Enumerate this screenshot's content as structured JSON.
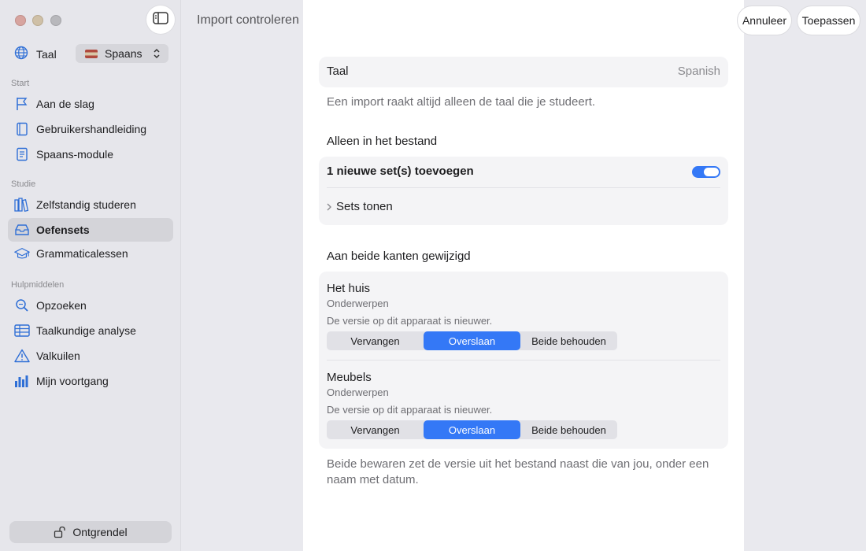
{
  "sidebar": {
    "language_label": "Taal",
    "language_value": "Spaans",
    "sections": [
      {
        "title": "Start",
        "items": [
          {
            "label": "Aan de slag",
            "icon": "flag-icon"
          },
          {
            "label": "Gebruikershandleiding",
            "icon": "book-icon"
          },
          {
            "label": "Spaans-module",
            "icon": "document-icon"
          }
        ]
      },
      {
        "title": "Studie",
        "items": [
          {
            "label": "Zelfstandig studeren",
            "icon": "books-icon"
          },
          {
            "label": "Oefensets",
            "icon": "tray-icon",
            "active": true
          },
          {
            "label": "Grammaticalessen",
            "icon": "graduation-cap-icon"
          }
        ]
      },
      {
        "title": "Hulpmiddelen",
        "items": [
          {
            "label": "Opzoeken",
            "icon": "magnifier-icon"
          },
          {
            "label": "Taalkundige analyse",
            "icon": "table-icon"
          },
          {
            "label": "Valkuilen",
            "icon": "warning-icon"
          },
          {
            "label": "Mijn voortgang",
            "icon": "chart-icon"
          }
        ]
      }
    ],
    "unlock_label": "Ontgrendel"
  },
  "header": {
    "title": "Import controleren",
    "cancel_label": "Annuleer",
    "apply_label": "Toepassen"
  },
  "main": {
    "language_row": {
      "label": "Taal",
      "value": "Spanish"
    },
    "language_hint": "Een import raakt altijd alleen de taal die je studeert.",
    "file_only_heading": "Alleen in het bestand",
    "add_sets_label": "1 nieuwe set(s) toevoegen",
    "add_sets_enabled": true,
    "show_sets_label": "Sets tonen",
    "changed_heading": "Aan beide kanten gewijzigd",
    "conflicts": [
      {
        "title": "Het huis",
        "subtitle": "Onderwerpen",
        "note": "De versie op dit apparaat is nieuwer.",
        "options": [
          "Vervangen",
          "Overslaan",
          "Beide behouden"
        ],
        "selected": "Overslaan"
      },
      {
        "title": "Meubels",
        "subtitle": "Onderwerpen",
        "note": "De versie op dit apparaat is nieuwer.",
        "options": [
          "Vervangen",
          "Overslaan",
          "Beide behouden"
        ],
        "selected": "Overslaan"
      }
    ],
    "footer_hint_line1": "Beide bewaren zet de versie uit het bestand naast die van jou, onder een",
    "footer_hint_line2": "naam met datum."
  },
  "colors": {
    "accent": "#3478f6"
  }
}
